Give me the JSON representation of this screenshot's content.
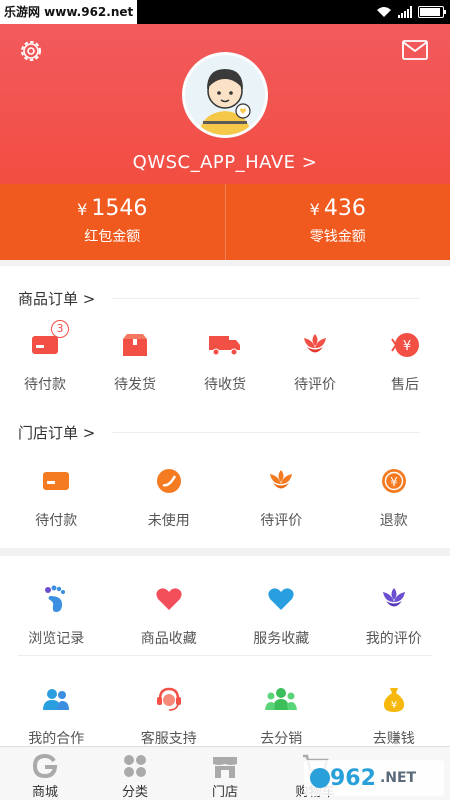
{
  "statusbar": {
    "watermark": "乐游网 www.962.net"
  },
  "header": {
    "username": "QWSC_APP_HAVE >",
    "wallet": [
      {
        "currency": "¥",
        "amount": "1546",
        "label": "红包金额"
      },
      {
        "currency": "¥",
        "amount": "436",
        "label": "零钱金额"
      }
    ]
  },
  "goods_orders": {
    "title": "商品订单 >",
    "items": [
      {
        "label": "待付款",
        "icon": "card-icon",
        "badge": "3"
      },
      {
        "label": "待发货",
        "icon": "package-icon"
      },
      {
        "label": "待收货",
        "icon": "truck-icon"
      },
      {
        "label": "待评价",
        "icon": "flower-icon"
      },
      {
        "label": "售后",
        "icon": "refund-coin-icon"
      }
    ]
  },
  "store_orders": {
    "title": "门店订单 >",
    "items": [
      {
        "label": "待付款",
        "icon": "card-icon"
      },
      {
        "label": "未使用",
        "icon": "ticket-icon"
      },
      {
        "label": "待评价",
        "icon": "flower-icon"
      },
      {
        "label": "退款",
        "icon": "yen-coin-icon"
      }
    ]
  },
  "services": {
    "row1": [
      {
        "label": "浏览记录",
        "icon": "footprint-icon"
      },
      {
        "label": "商品收藏",
        "icon": "heart-icon"
      },
      {
        "label": "服务收藏",
        "icon": "heart-icon"
      },
      {
        "label": "我的评价",
        "icon": "flower-icon"
      }
    ],
    "row2": [
      {
        "label": "我的合作",
        "icon": "partners-icon"
      },
      {
        "label": "客服支持",
        "icon": "headset-icon"
      },
      {
        "label": "去分销",
        "icon": "group-icon"
      },
      {
        "label": "去赚钱",
        "icon": "money-bag-icon"
      }
    ]
  },
  "tabbar": [
    {
      "label": "商城",
      "icon": "g-logo-icon"
    },
    {
      "label": "分类",
      "icon": "grid-icon"
    },
    {
      "label": "门店",
      "icon": "store-icon"
    },
    {
      "label": "购物车",
      "icon": "cart-icon"
    }
  ],
  "watermark": {
    "brand_num": "962",
    "brand_tld": ".NET",
    "brand_cn": "乐游网"
  },
  "colors": {
    "primary": "#f24f45",
    "wallet_bar": "#f15a1f",
    "orange": "#f47b22",
    "blue": "#2a9fe0",
    "purple": "#6b4fd0",
    "green": "#3cbf5a"
  }
}
